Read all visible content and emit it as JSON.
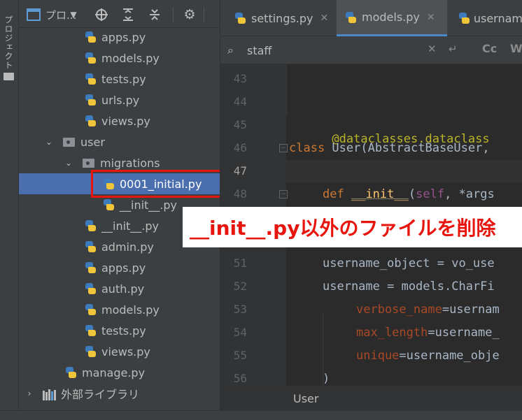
{
  "side_strip": {
    "label": "プロジェクト"
  },
  "project_panel": {
    "title": "プロ...",
    "tree": [
      {
        "label": "apps.py",
        "type": "py"
      },
      {
        "label": "models.py",
        "type": "py"
      },
      {
        "label": "tests.py",
        "type": "py"
      },
      {
        "label": "urls.py",
        "type": "py"
      },
      {
        "label": "views.py",
        "type": "py"
      },
      {
        "label": "user",
        "type": "folder",
        "expanded": true
      },
      {
        "label": "migrations",
        "type": "folder",
        "expanded": true
      },
      {
        "label": "0001_initial.py",
        "type": "py",
        "selected": true
      },
      {
        "label": "__init__.py",
        "type": "py"
      },
      {
        "label": "__init__.py",
        "type": "py"
      },
      {
        "label": "admin.py",
        "type": "py"
      },
      {
        "label": "apps.py",
        "type": "py"
      },
      {
        "label": "auth.py",
        "type": "py"
      },
      {
        "label": "models.py",
        "type": "py"
      },
      {
        "label": "tests.py",
        "type": "py"
      },
      {
        "label": "views.py",
        "type": "py"
      },
      {
        "label": "manage.py",
        "type": "py"
      },
      {
        "label": "外部ライブラリ",
        "type": "library",
        "expanded": false
      }
    ]
  },
  "tabs": [
    {
      "label": "settings.py",
      "active": false
    },
    {
      "label": "models.py",
      "active": true
    },
    {
      "label": "usernam",
      "active": false
    }
  ],
  "search": {
    "value": "staff",
    "case_label": "Cc",
    "word_label": "W"
  },
  "editor": {
    "line_numbers": [
      "43",
      "44",
      "45",
      "46",
      "47",
      "48",
      "51",
      "52",
      "53",
      "54",
      "55",
      "56"
    ],
    "code": {
      "l45": "@dataclasses.dataclass",
      "l46_kw": "class",
      "l46_rest": " User(AbstractBaseUser,",
      "l48_kw": "def",
      "l48_fn": "__init__",
      "l48_open": "(",
      "l48_self": "self",
      "l48_rest": ", *args",
      "l51": "username_object = vo_use",
      "l52": "username = models.CharFi",
      "l53_param": "verbose_name",
      "l53_rest": "=usernam",
      "l54_param": "max_length",
      "l54_rest": "=username_",
      "l55_param": "unique",
      "l55_rest": "=username_obje",
      "l56": ")"
    },
    "breadcrumb": "User"
  },
  "callout": {
    "text": "__init__.py以外のファイルを削除"
  },
  "colors": {
    "selection": "#4b6eaf",
    "highlight_box": "#e8140e",
    "callout_text": "#e8140e"
  }
}
